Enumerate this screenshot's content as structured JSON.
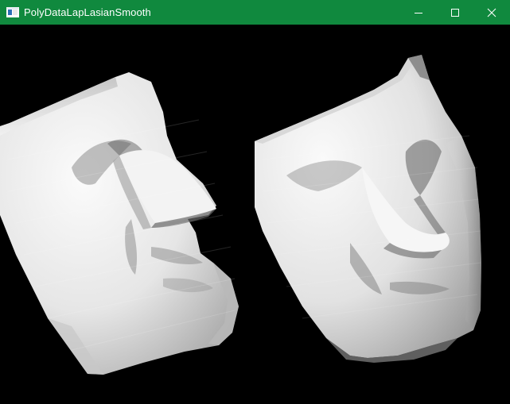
{
  "window": {
    "title": "PolyDataLapLasianSmooth",
    "titlebar_color": "#10893e",
    "background_color": "#000000",
    "app_icon": "vtk-window-icon",
    "controls": {
      "minimize": "minimize-icon",
      "maximize": "maximize-icon",
      "close": "close-icon"
    }
  },
  "viewport": {
    "left_model": "face-mesh-side-view",
    "right_model": "face-mesh-smoothed-front-view"
  }
}
